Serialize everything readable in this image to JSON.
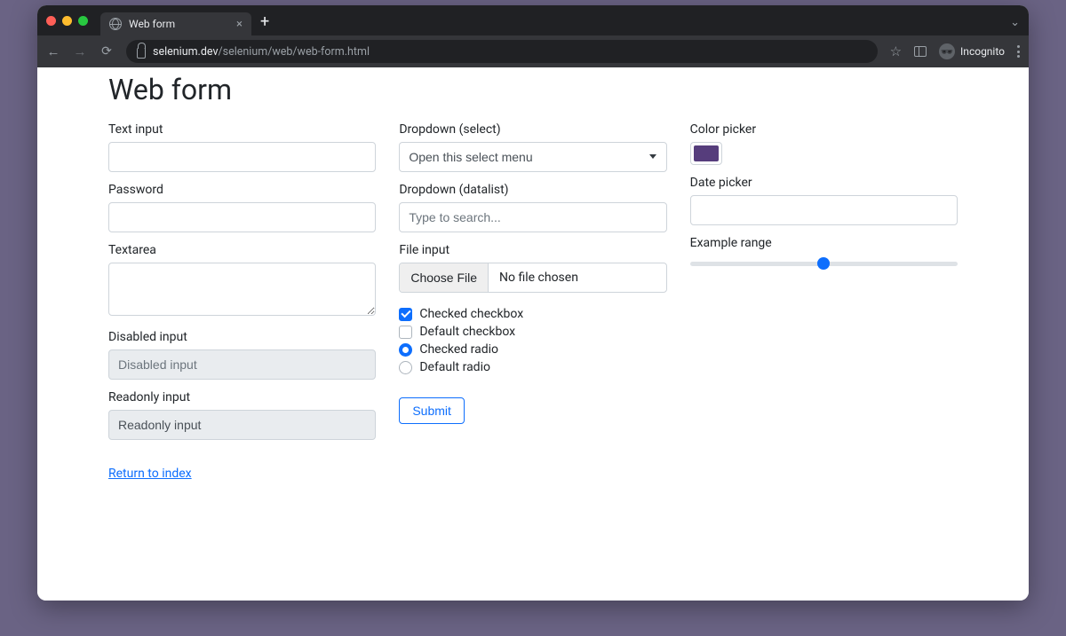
{
  "browser": {
    "tab_title": "Web form",
    "url_domain": "selenium.dev",
    "url_path": "/selenium/web/web-form.html",
    "incognito_label": "Incognito"
  },
  "page": {
    "title": "Web form",
    "col1": {
      "text_input": {
        "label": "Text input",
        "value": ""
      },
      "password": {
        "label": "Password",
        "value": ""
      },
      "textarea": {
        "label": "Textarea",
        "value": ""
      },
      "disabled": {
        "label": "Disabled input",
        "placeholder": "Disabled input"
      },
      "readonly": {
        "label": "Readonly input",
        "value": "Readonly input"
      }
    },
    "col2": {
      "select": {
        "label": "Dropdown (select)",
        "selected": "Open this select menu"
      },
      "datalist": {
        "label": "Dropdown (datalist)",
        "placeholder": "Type to search..."
      },
      "file": {
        "label": "File input",
        "button": "Choose File",
        "status": "No file chosen"
      },
      "cb1": {
        "label": "Checked checkbox",
        "checked": true
      },
      "cb2": {
        "label": "Default checkbox",
        "checked": false
      },
      "rb1": {
        "label": "Checked radio",
        "checked": true
      },
      "rb2": {
        "label": "Default radio",
        "checked": false
      },
      "submit": "Submit"
    },
    "col3": {
      "color": {
        "label": "Color picker",
        "value": "#563d7c"
      },
      "date": {
        "label": "Date picker",
        "value": ""
      },
      "range": {
        "label": "Example range",
        "value": 5,
        "min": 0,
        "max": 10
      }
    },
    "return_link": "Return to index"
  }
}
